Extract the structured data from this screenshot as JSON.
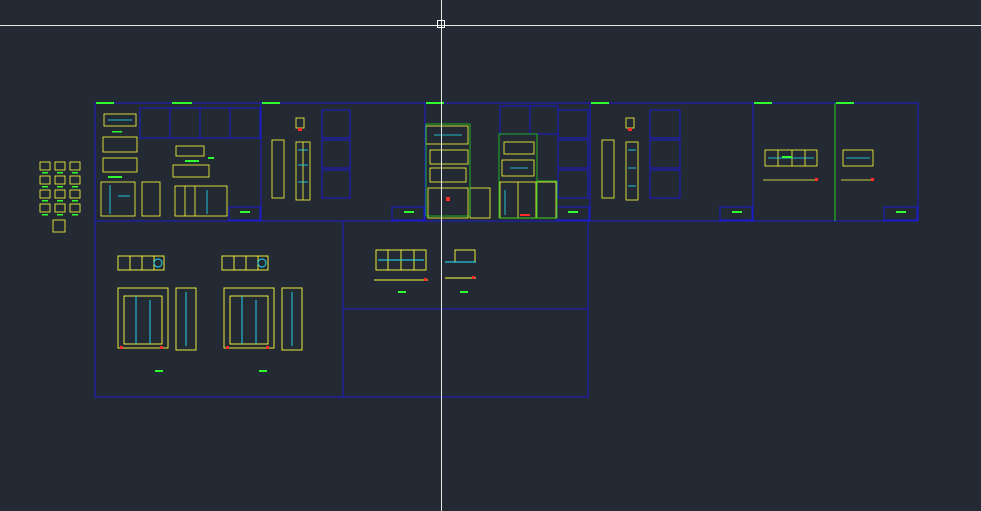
{
  "viewport": {
    "background": "#242a33",
    "drawing_colors": {
      "frame": "#1b1bd0",
      "outline": "#ffff3c",
      "accent": "#22e6ff",
      "label": "#2fff2f",
      "dimension": "#ff2a2a",
      "section": "#1ecf1e",
      "crosshair": "#e8e8e8"
    }
  },
  "cursor": {
    "type": "crosshair-with-pickbox"
  }
}
